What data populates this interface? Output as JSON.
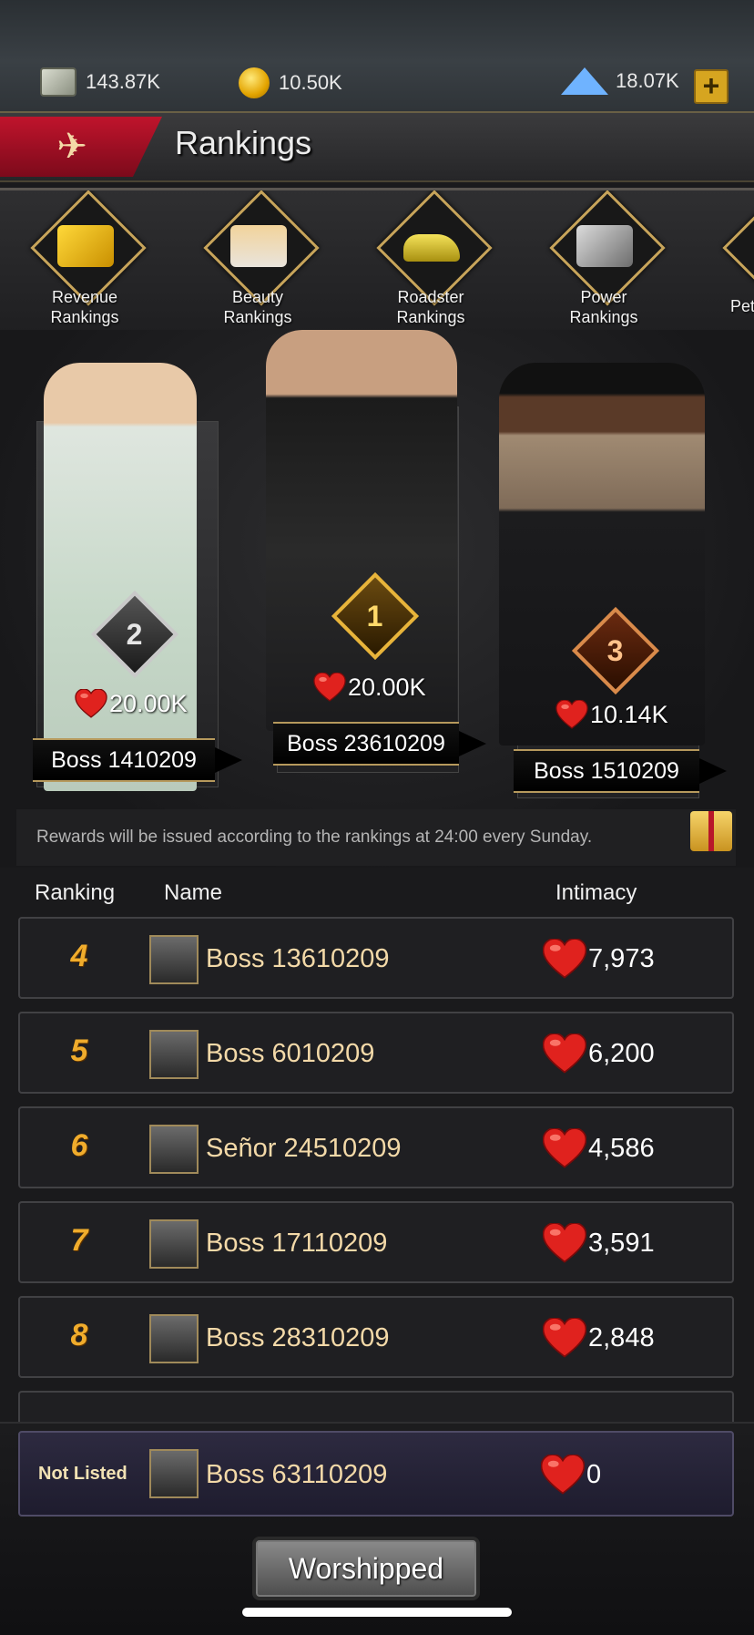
{
  "resources": {
    "cash": "143.87K",
    "coins": "10.50K",
    "diamonds": "18.07K",
    "add_label": "+"
  },
  "header": {
    "title": "Rankings",
    "back_icon": "wing-arrow-icon"
  },
  "categories": [
    {
      "label1": "Revenue",
      "label2": "Rankings",
      "icon": "money-icon"
    },
    {
      "label1": "Beauty",
      "label2": "Rankings",
      "icon": "beauty-portrait-icon"
    },
    {
      "label1": "Roadster",
      "label2": "Rankings",
      "icon": "sports-car-icon"
    },
    {
      "label1": "Power",
      "label2": "Rankings",
      "icon": "crossed-guns-icon"
    },
    {
      "label1": "Pet",
      "label2": "",
      "icon": "pet-icon"
    }
  ],
  "podium": [
    {
      "rank": "2",
      "score": "20.00K",
      "name": "Boss 1410209"
    },
    {
      "rank": "1",
      "score": "20.00K",
      "name": "Boss 23610209"
    },
    {
      "rank": "3",
      "score": "10.14K",
      "name": "Boss 1510209"
    }
  ],
  "rewards_note": "Rewards will be issued according to the rankings at 24:00 every Sunday.",
  "list_headers": {
    "ranking": "Ranking",
    "name": "Name",
    "intimacy": "Intimacy"
  },
  "rows": [
    {
      "rank": "4",
      "name": "Boss 13610209",
      "score": "7,973"
    },
    {
      "rank": "5",
      "name": "Boss 6010209",
      "score": "6,200"
    },
    {
      "rank": "6",
      "name": "Señor 24510209",
      "score": "4,586"
    },
    {
      "rank": "7",
      "name": "Boss 17110209",
      "score": "3,591"
    },
    {
      "rank": "8",
      "name": "Boss 28310209",
      "score": "2,848"
    }
  ],
  "my_rank": {
    "rank": "Not Listed",
    "name": "Boss 63110209",
    "score": "0"
  },
  "worship_button": "Worshipped",
  "colors": {
    "accent_gold": "#f0ac2c",
    "heart_red": "#e0221e",
    "back_red": "#c0142c"
  }
}
